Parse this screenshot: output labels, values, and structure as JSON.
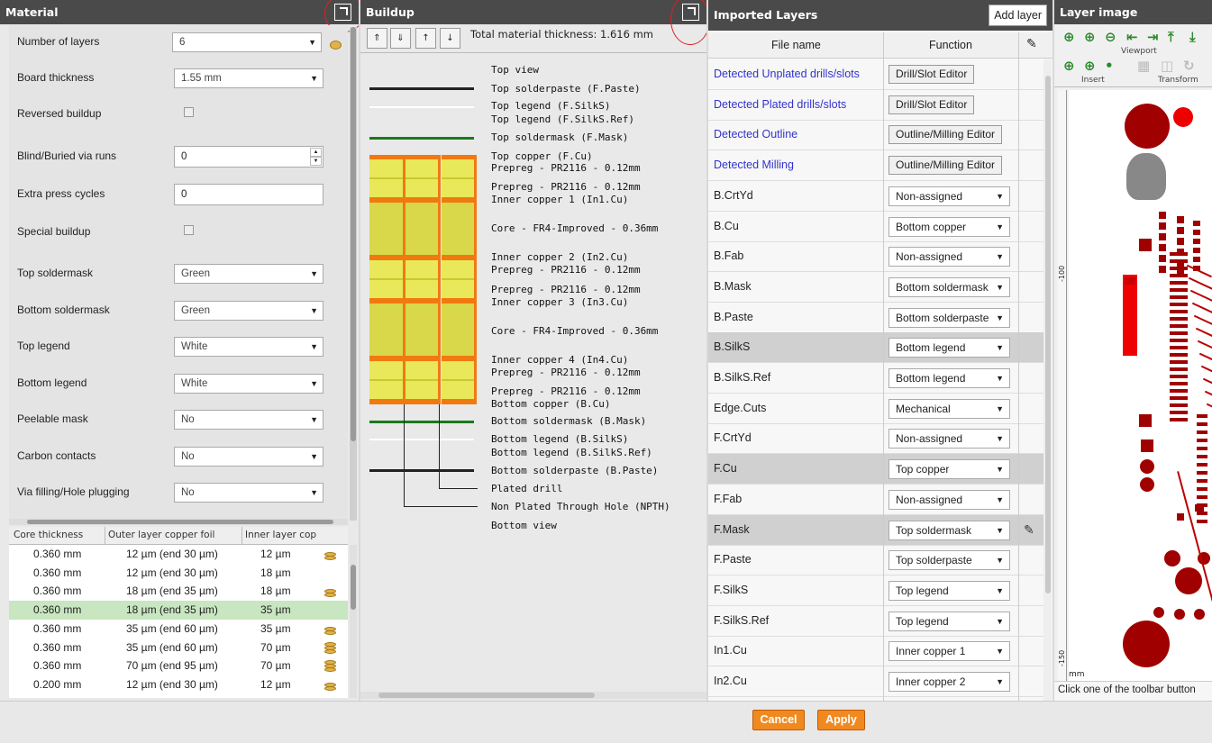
{
  "material": {
    "title": "Material",
    "fields": [
      {
        "label": "Number of layers",
        "kind": "select",
        "value": "6",
        "coin": true
      },
      {
        "label": "Board thickness",
        "kind": "select",
        "value": "1.55 mm"
      },
      {
        "label": "Reversed buildup",
        "kind": "checkbox",
        "checked": false
      },
      {
        "label": "Blind/Buried via runs",
        "kind": "spin",
        "value": "0"
      },
      {
        "label": "Extra press cycles",
        "kind": "text",
        "value": "0"
      },
      {
        "label": "Special buildup",
        "kind": "checkbox",
        "checked": false
      },
      {
        "label": "Top soldermask",
        "kind": "select",
        "value": "Green"
      },
      {
        "label": "Bottom soldermask",
        "kind": "select",
        "value": "Green"
      },
      {
        "label": "Top legend",
        "kind": "select",
        "value": "White"
      },
      {
        "label": "Bottom legend",
        "kind": "select",
        "value": "White"
      },
      {
        "label": "Peelable mask",
        "kind": "select",
        "value": "No"
      },
      {
        "label": "Carbon contacts",
        "kind": "select",
        "value": "No"
      },
      {
        "label": "Via filling/Hole plugging",
        "kind": "select",
        "value": "No"
      }
    ],
    "core_table": {
      "headers": [
        "Core thickness",
        "Outer layer copper foil",
        "Inner layer cop"
      ],
      "rows": [
        {
          "core": "0.360 mm",
          "outer": "12 µm (end 30 µm)",
          "inner": "12 µm",
          "coin": "stack2",
          "selected": false
        },
        {
          "core": "0.360 mm",
          "outer": "12 µm (end 30 µm)",
          "inner": "18 µm",
          "coin": "none",
          "selected": false
        },
        {
          "core": "0.360 mm",
          "outer": "18 µm (end 35 µm)",
          "inner": "18 µm",
          "coin": "stack2",
          "selected": false
        },
        {
          "core": "0.360 mm",
          "outer": "18 µm (end 35 µm)",
          "inner": "35 µm",
          "coin": "none",
          "selected": true
        },
        {
          "core": "0.360 mm",
          "outer": "35 µm (end 60 µm)",
          "inner": "35 µm",
          "coin": "stack2",
          "selected": false
        },
        {
          "core": "0.360 mm",
          "outer": "35 µm (end 60 µm)",
          "inner": "70 µm",
          "coin": "stack3",
          "selected": false
        },
        {
          "core": "0.360 mm",
          "outer": "70 µm (end 95 µm)",
          "inner": "70 µm",
          "coin": "stack3",
          "selected": false
        },
        {
          "core": "0.200 mm",
          "outer": "12 µm (end 30 µm)",
          "inner": "12 µm",
          "coin": "stack2",
          "selected": false
        }
      ]
    }
  },
  "buildup": {
    "title": "Buildup",
    "total_label": "Total material thickness: 1.616 mm",
    "tool_icons": [
      "move-up-icon",
      "move-down-icon",
      "move-top-icon",
      "move-bottom-icon"
    ],
    "labels": [
      "Top view",
      "Top solderpaste (F.Paste)",
      "Top legend (F.SilkS)",
      "Top legend (F.SilkS.Ref)",
      "Top soldermask (F.Mask)",
      "Top copper (F.Cu)",
      "Prepreg - PR2116 - 0.12mm",
      "Prepreg - PR2116 - 0.12mm",
      "Inner copper 1 (In1.Cu)",
      "Core - FR4-Improved - 0.36mm",
      "Inner copper 2 (In2.Cu)",
      "Prepreg - PR2116 - 0.12mm",
      "Prepreg - PR2116 - 0.12mm",
      "Inner copper 3 (In3.Cu)",
      "Core - FR4-Improved - 0.36mm",
      "Inner copper 4 (In4.Cu)",
      "Prepreg - PR2116 - 0.12mm",
      "Prepreg - PR2116 - 0.12mm",
      "Bottom copper (B.Cu)",
      "Bottom soldermask (B.Mask)",
      "Bottom legend (B.SilkS)",
      "Bottom legend (B.SilkS.Ref)",
      "Bottom solderpaste (B.Paste)",
      "Plated drill",
      "Non Plated Through Hole (NPTH)",
      "Bottom view"
    ]
  },
  "imported": {
    "title": "Imported Layers",
    "add_layer": "Add layer",
    "col_file": "File name",
    "col_function": "Function",
    "rows": [
      {
        "name": "Detected Unplated drills/slots",
        "link": true,
        "kind": "button",
        "value": "Drill/Slot Editor",
        "selected": false,
        "pencil": false
      },
      {
        "name": "Detected Plated drills/slots",
        "link": true,
        "kind": "button",
        "value": "Drill/Slot Editor",
        "selected": false,
        "pencil": false
      },
      {
        "name": "Detected Outline",
        "link": true,
        "kind": "button",
        "value": "Outline/Milling Editor",
        "selected": false,
        "pencil": false
      },
      {
        "name": "Detected Milling",
        "link": true,
        "kind": "button",
        "value": "Outline/Milling Editor",
        "selected": false,
        "pencil": false
      },
      {
        "name": "B.CrtYd",
        "link": false,
        "kind": "select",
        "value": "Non-assigned",
        "selected": false,
        "pencil": false
      },
      {
        "name": "B.Cu",
        "link": false,
        "kind": "select",
        "value": "Bottom copper",
        "selected": false,
        "pencil": false
      },
      {
        "name": "B.Fab",
        "link": false,
        "kind": "select",
        "value": "Non-assigned",
        "selected": false,
        "pencil": false
      },
      {
        "name": "B.Mask",
        "link": false,
        "kind": "select",
        "value": "Bottom soldermask",
        "selected": false,
        "pencil": false
      },
      {
        "name": "B.Paste",
        "link": false,
        "kind": "select",
        "value": "Bottom solderpaste",
        "selected": false,
        "pencil": false
      },
      {
        "name": "B.SilkS",
        "link": false,
        "kind": "select",
        "value": "Bottom legend",
        "selected": true,
        "pencil": false
      },
      {
        "name": "B.SilkS.Ref",
        "link": false,
        "kind": "select",
        "value": "Bottom legend",
        "selected": false,
        "pencil": false
      },
      {
        "name": "Edge.Cuts",
        "link": false,
        "kind": "select",
        "value": "Mechanical",
        "selected": false,
        "pencil": false
      },
      {
        "name": "F.CrtYd",
        "link": false,
        "kind": "select",
        "value": "Non-assigned",
        "selected": false,
        "pencil": false
      },
      {
        "name": "F.Cu",
        "link": false,
        "kind": "select",
        "value": "Top copper",
        "selected": true,
        "pencil": false
      },
      {
        "name": "F.Fab",
        "link": false,
        "kind": "select",
        "value": "Non-assigned",
        "selected": false,
        "pencil": false
      },
      {
        "name": "F.Mask",
        "link": false,
        "kind": "select",
        "value": "Top soldermask",
        "selected": true,
        "pencil": true
      },
      {
        "name": "F.Paste",
        "link": false,
        "kind": "select",
        "value": "Top solderpaste",
        "selected": false,
        "pencil": false
      },
      {
        "name": "F.SilkS",
        "link": false,
        "kind": "select",
        "value": "Top legend",
        "selected": false,
        "pencil": false
      },
      {
        "name": "F.SilkS.Ref",
        "link": false,
        "kind": "select",
        "value": "Top legend",
        "selected": false,
        "pencil": false
      },
      {
        "name": "In1.Cu",
        "link": false,
        "kind": "select",
        "value": "Inner copper 1",
        "selected": false,
        "pencil": false
      },
      {
        "name": "In2.Cu",
        "link": false,
        "kind": "select",
        "value": "Inner copper 2",
        "selected": false,
        "pencil": false
      },
      {
        "name": "",
        "link": false,
        "kind": "select",
        "value": "",
        "selected": false,
        "pencil": false
      }
    ]
  },
  "layer_image": {
    "title": "Layer image",
    "viewport_caption": "Viewport",
    "insert_caption": "Insert",
    "transform_caption": "Transform",
    "ruler_label_100": "-100",
    "ruler_label_150": "-150",
    "ruler_unit": "mm",
    "hint": "Click one of the toolbar button"
  },
  "footer": {
    "cancel": "Cancel",
    "apply": "Apply"
  },
  "colors": {
    "accent_orange": "#f08a20",
    "copper": "#f07a10",
    "core": "#d8d84a",
    "prepreg": "#e8e85a",
    "mask": "#1a7a1a",
    "board_red": "#a00000",
    "selected_row": "#c8e6c0"
  }
}
